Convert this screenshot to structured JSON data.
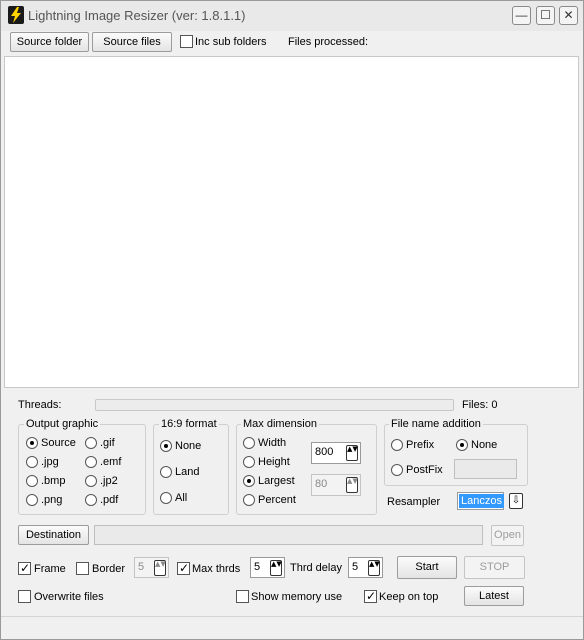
{
  "window": {
    "title": "Lightning Image Resizer (ver: 1.8.1.1)",
    "icon": "lightning-icon",
    "min_glyph": "—",
    "max_glyph": "☐",
    "close_glyph": "✕"
  },
  "toolbar": {
    "source_folder_label": "Source folder",
    "source_files_label": "Source files",
    "inc_sub_folders_label": "Inc sub folders",
    "inc_sub_folders_checked": false,
    "files_processed_label": "Files processed:"
  },
  "status": {
    "threads_label": "Threads:",
    "threads_progress": 0,
    "files_label": "Files: 0"
  },
  "output_graphic": {
    "title": "Output graphic",
    "options": [
      "Source",
      ".jpg",
      ".bmp",
      ".png",
      ".gif",
      ".emf",
      ".jp2",
      ".pdf"
    ],
    "selected": "Source"
  },
  "format169": {
    "title": "16:9 format",
    "options": [
      "None",
      "Land",
      "All"
    ],
    "selected": "None"
  },
  "max_dimension": {
    "title": "Max dimension",
    "options": [
      "Width",
      "Height",
      "Largest",
      "Percent"
    ],
    "selected": "Largest",
    "size_value": "800",
    "percent_value": "80"
  },
  "file_name_addition": {
    "title": "File name addition",
    "prefix_label": "Prefix",
    "none_label": "None",
    "postfix_label": "PostFix",
    "selected": "None",
    "text_value": ""
  },
  "resampler": {
    "label": "Resampler",
    "value": "Lanczos",
    "arrow": "⇩"
  },
  "destination": {
    "button_label": "Destination",
    "path_value": "",
    "open_label": "Open"
  },
  "options_row": {
    "frame_label": "Frame",
    "frame_checked": true,
    "border_label": "Border",
    "border_checked": false,
    "border_value": "5",
    "max_thrds_label": "Max thrds",
    "max_thrds_checked": true,
    "max_thrds_value": "5",
    "thrd_delay_label": "Thrd delay",
    "thrd_delay_value": "5",
    "start_label": "Start",
    "stop_label": "STOP"
  },
  "bottom_row": {
    "overwrite_label": "Overwrite files",
    "overwrite_checked": false,
    "show_memory_label": "Show memory use",
    "show_memory_checked": false,
    "keep_on_top_label": "Keep on top",
    "keep_on_top_checked": true,
    "latest_label": "Latest"
  },
  "spin_arrows": "▲▼",
  "colors": {
    "selection": "#3399ff",
    "window_bg": "#f0f0f0",
    "list_bg": "#ffffff"
  }
}
